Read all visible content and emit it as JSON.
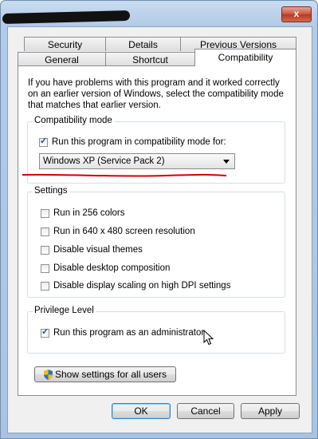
{
  "window": {
    "close_label": "x"
  },
  "tabs": {
    "row_back": [
      "Security",
      "Details",
      "Previous Versions"
    ],
    "row_front": [
      "General",
      "Shortcut",
      "Compatibility"
    ],
    "selected": "Compatibility"
  },
  "intro_text": "If you have problems with this program and it worked correctly on an earlier version of Windows, select the compatibility mode that matches that earlier version.",
  "compat_mode": {
    "title": "Compatibility mode",
    "checkbox_label": "Run this program in compatibility mode for:",
    "checked": true,
    "selected_os": "Windows XP (Service Pack 2)"
  },
  "settings": {
    "title": "Settings",
    "items": [
      {
        "label": "Run in 256 colors",
        "checked": false
      },
      {
        "label": "Run in 640 x 480 screen resolution",
        "checked": false
      },
      {
        "label": "Disable visual themes",
        "checked": false
      },
      {
        "label": "Disable desktop composition",
        "checked": false
      },
      {
        "label": "Disable display scaling on high DPI settings",
        "checked": false
      }
    ]
  },
  "privilege": {
    "title": "Privilege Level",
    "checkbox_label": "Run this program as an administrator",
    "checked": true
  },
  "show_all_users_label": "Show settings for all users",
  "buttons": {
    "ok": "OK",
    "cancel": "Cancel",
    "apply": "Apply"
  },
  "colors": {
    "annotation_underline": "#d40000",
    "shield_blue": "#2f6fc8",
    "shield_yellow": "#f2c200"
  }
}
